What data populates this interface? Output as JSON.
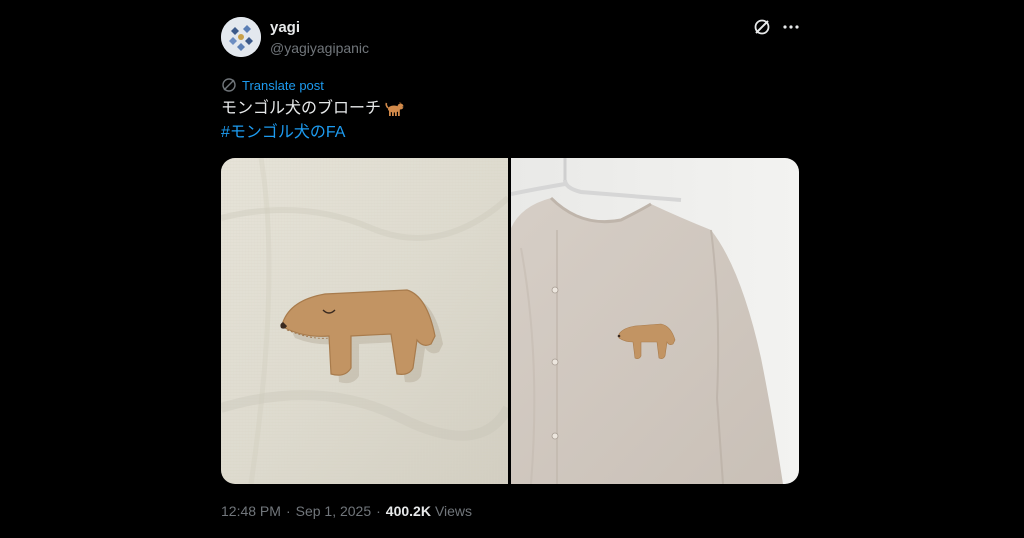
{
  "user": {
    "name": "yagi",
    "handle": "@yagiyagipanic",
    "avatar_icon": "avatar-image"
  },
  "header_actions": {
    "grok_icon": "grok-icon",
    "more_icon": "more-icon"
  },
  "post": {
    "translate_label": "Translate post",
    "text": "モンゴル犬のブローチ",
    "text_emoji": "dog-emoji",
    "hashtag": "#モンゴル犬のFA"
  },
  "media": {
    "images": [
      "felt-dog-brooch-on-linen",
      "felt-dog-brooch-on-blouse"
    ]
  },
  "meta": {
    "time": "12:48 PM",
    "separator": "·",
    "date": "Sep 1, 2025",
    "views_count": "400.2K",
    "views_label": "Views"
  },
  "colors": {
    "background": "#000000",
    "text": "#e7e9ea",
    "secondary": "#71767b",
    "link": "#1d9bf0"
  }
}
